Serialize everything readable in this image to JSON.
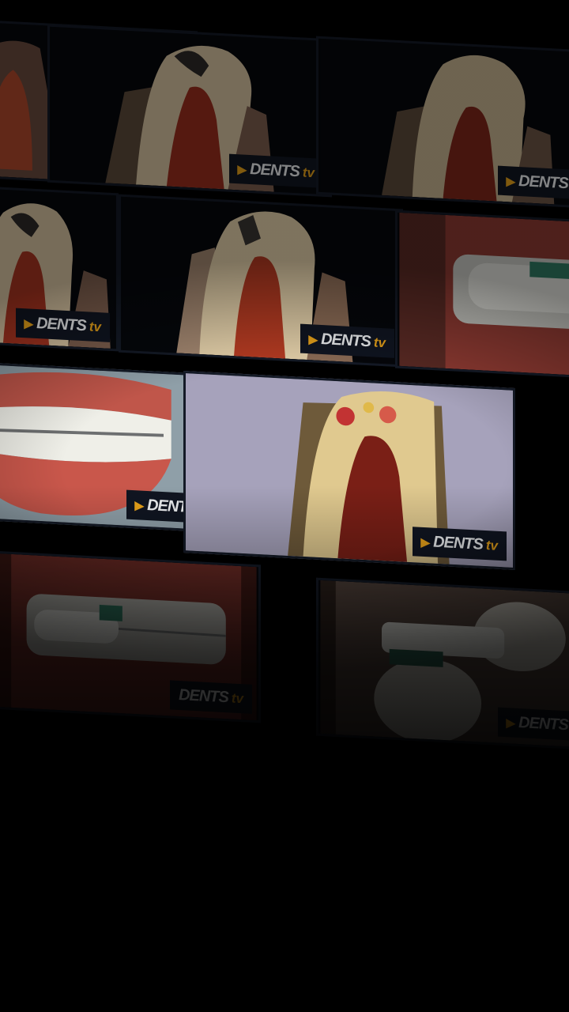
{
  "brand": {
    "logo_main": "DENTS",
    "logo_suffix": "tv",
    "accent_color": "#e9a31a",
    "badge_bg": "#101521"
  },
  "tiles": [
    {
      "subject": "tooth-cross-section"
    },
    {
      "subject": "tooth-cross-section"
    },
    {
      "subject": "tooth-cross-section"
    },
    {
      "subject": "tooth-cross-section"
    },
    {
      "subject": "tooth-cross-section"
    },
    {
      "subject": "toothbrush-braces"
    },
    {
      "subject": "teeth-smile"
    },
    {
      "subject": "tooth-decay"
    },
    {
      "subject": "toothbrush-braces"
    },
    {
      "subject": "toothbrush-molars"
    }
  ]
}
